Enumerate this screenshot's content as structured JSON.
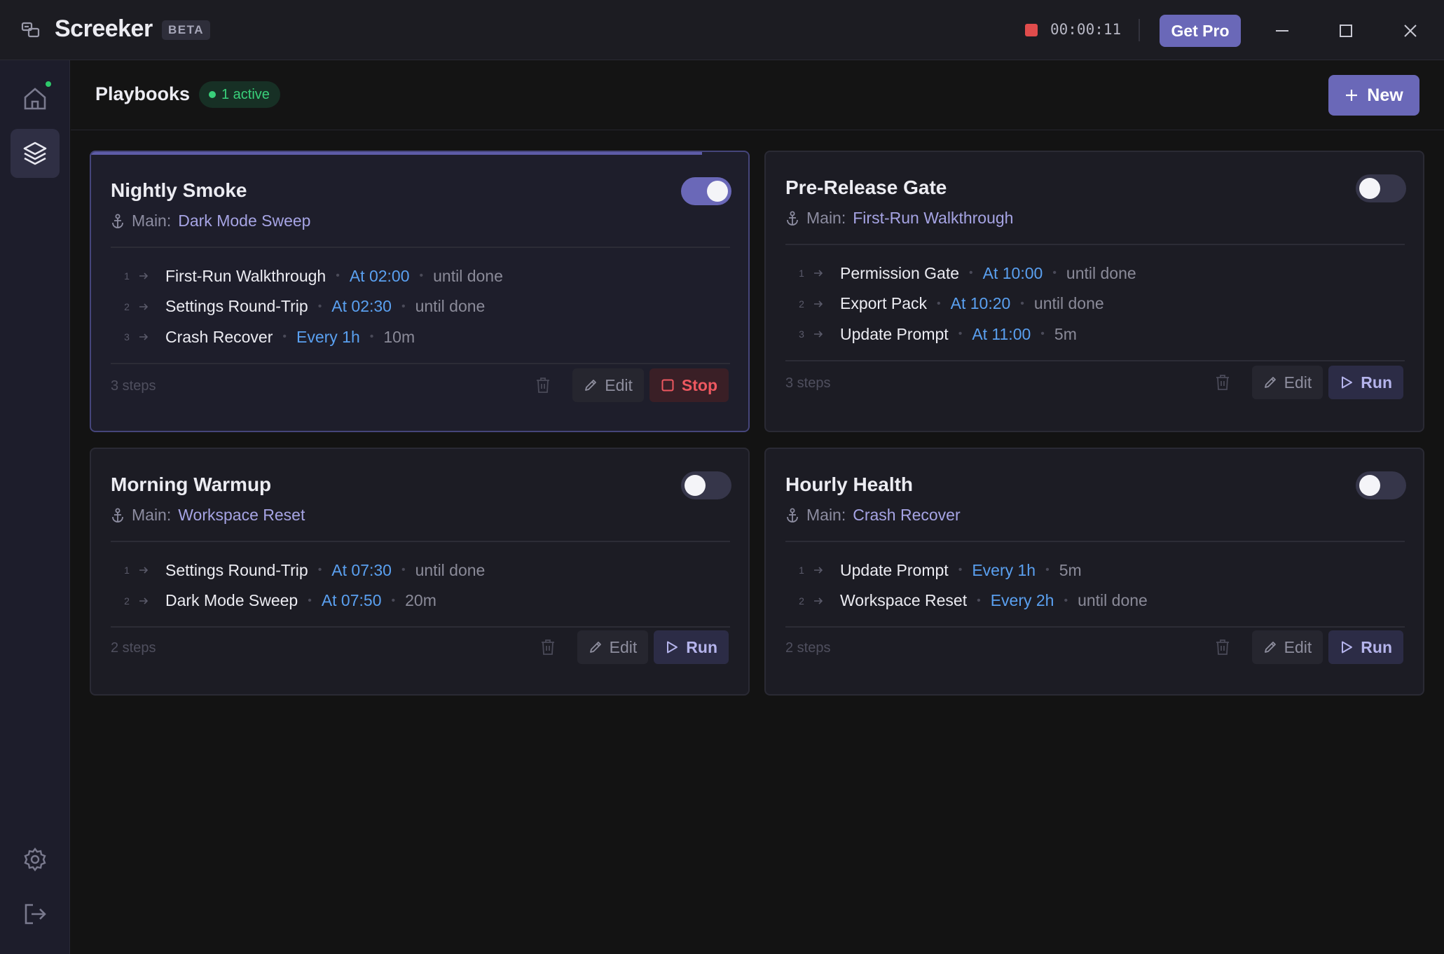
{
  "app": {
    "name": "Screeker",
    "badge": "BETA"
  },
  "recording": {
    "time": "00:00:11"
  },
  "titlebar": {
    "get_pro": "Get Pro"
  },
  "header": {
    "title": "Playbooks",
    "active_badge": "1 active",
    "new_label": "New"
  },
  "colors": {
    "accent": "#6a68b8",
    "active_green": "#39d07a",
    "schedule_blue": "#5aa0f0",
    "stop_red": "#ee5860"
  },
  "cards": [
    {
      "title": "Nightly Smoke",
      "main_label": "Main:",
      "main_value": "Dark Mode Sweep",
      "enabled": true,
      "progress": 0.93,
      "steps": [
        {
          "num": "1",
          "name": "First-Run Walkthrough",
          "schedule": "At 02:00",
          "duration": "until done"
        },
        {
          "num": "2",
          "name": "Settings Round-Trip",
          "schedule": "At 02:30",
          "duration": "until done"
        },
        {
          "num": "3",
          "name": "Crash Recover",
          "schedule": "Every 1h",
          "duration": "10m"
        }
      ],
      "steps_count": "3 steps",
      "edit_label": "Edit",
      "action_label": "Stop"
    },
    {
      "title": "Pre-Release Gate",
      "main_label": "Main:",
      "main_value": "First-Run Walkthrough",
      "enabled": false,
      "steps": [
        {
          "num": "1",
          "name": "Permission Gate",
          "schedule": "At 10:00",
          "duration": "until done"
        },
        {
          "num": "2",
          "name": "Export Pack",
          "schedule": "At 10:20",
          "duration": "until done"
        },
        {
          "num": "3",
          "name": "Update Prompt",
          "schedule": "At 11:00",
          "duration": "5m"
        }
      ],
      "steps_count": "3 steps",
      "edit_label": "Edit",
      "action_label": "Run"
    },
    {
      "title": "Morning Warmup",
      "main_label": "Main:",
      "main_value": "Workspace Reset",
      "enabled": false,
      "steps": [
        {
          "num": "1",
          "name": "Settings Round-Trip",
          "schedule": "At 07:30",
          "duration": "until done"
        },
        {
          "num": "2",
          "name": "Dark Mode Sweep",
          "schedule": "At 07:50",
          "duration": "20m"
        }
      ],
      "steps_count": "2 steps",
      "edit_label": "Edit",
      "action_label": "Run"
    },
    {
      "title": "Hourly Health",
      "main_label": "Main:",
      "main_value": "Crash Recover",
      "enabled": false,
      "steps": [
        {
          "num": "1",
          "name": "Update Prompt",
          "schedule": "Every 1h",
          "duration": "5m"
        },
        {
          "num": "2",
          "name": "Workspace Reset",
          "schedule": "Every 2h",
          "duration": "until done"
        }
      ],
      "steps_count": "2 steps",
      "edit_label": "Edit",
      "action_label": "Run"
    }
  ]
}
